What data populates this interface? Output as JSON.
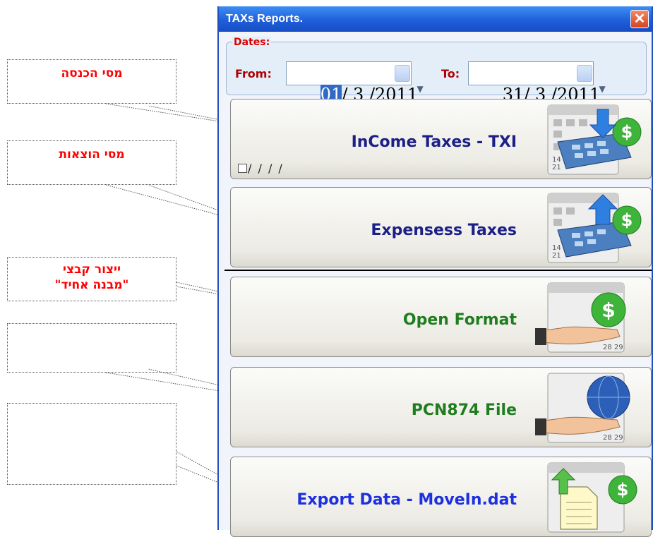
{
  "window": {
    "title": "TAXs Reports.",
    "close_glyph": "✕"
  },
  "dates": {
    "group_label": "Dates:",
    "from_label": "From:",
    "from_selected": "01",
    "from_rest": "/ 3 /2011",
    "to_label": "To:",
    "to_value": "31/ 3 /2011",
    "dropdown_glyph": "▼"
  },
  "buttons": {
    "income": {
      "label": "InCome Taxes - TXI",
      "icon": "calculator-down-arrow-icon",
      "pending": "/ / / /"
    },
    "expenses": {
      "label": "Expensess Taxes",
      "icon": "calculator-up-arrow-icon"
    },
    "open_format": {
      "label": "Open Format",
      "icon": "hand-coin-icon"
    },
    "pcn874": {
      "label": "PCN874 File",
      "icon": "hand-globe-icon"
    },
    "export": {
      "label": "Export Data - MoveIn.dat",
      "icon": "document-export-icon"
    }
  },
  "callouts": {
    "income": "מסי הכנסה",
    "expenses": "מסי הוצאות",
    "open_format_line1": "ייצור קבצי",
    "open_format_line2": "\"מבנה אחיד\"",
    "pcn874": "",
    "export": ""
  },
  "colors": {
    "titlebar": "#1f5fda",
    "callout_text": "#ff0000",
    "label_navy": "#1b1f86",
    "label_green": "#1f7d1f",
    "label_blue": "#1d2fe0"
  }
}
